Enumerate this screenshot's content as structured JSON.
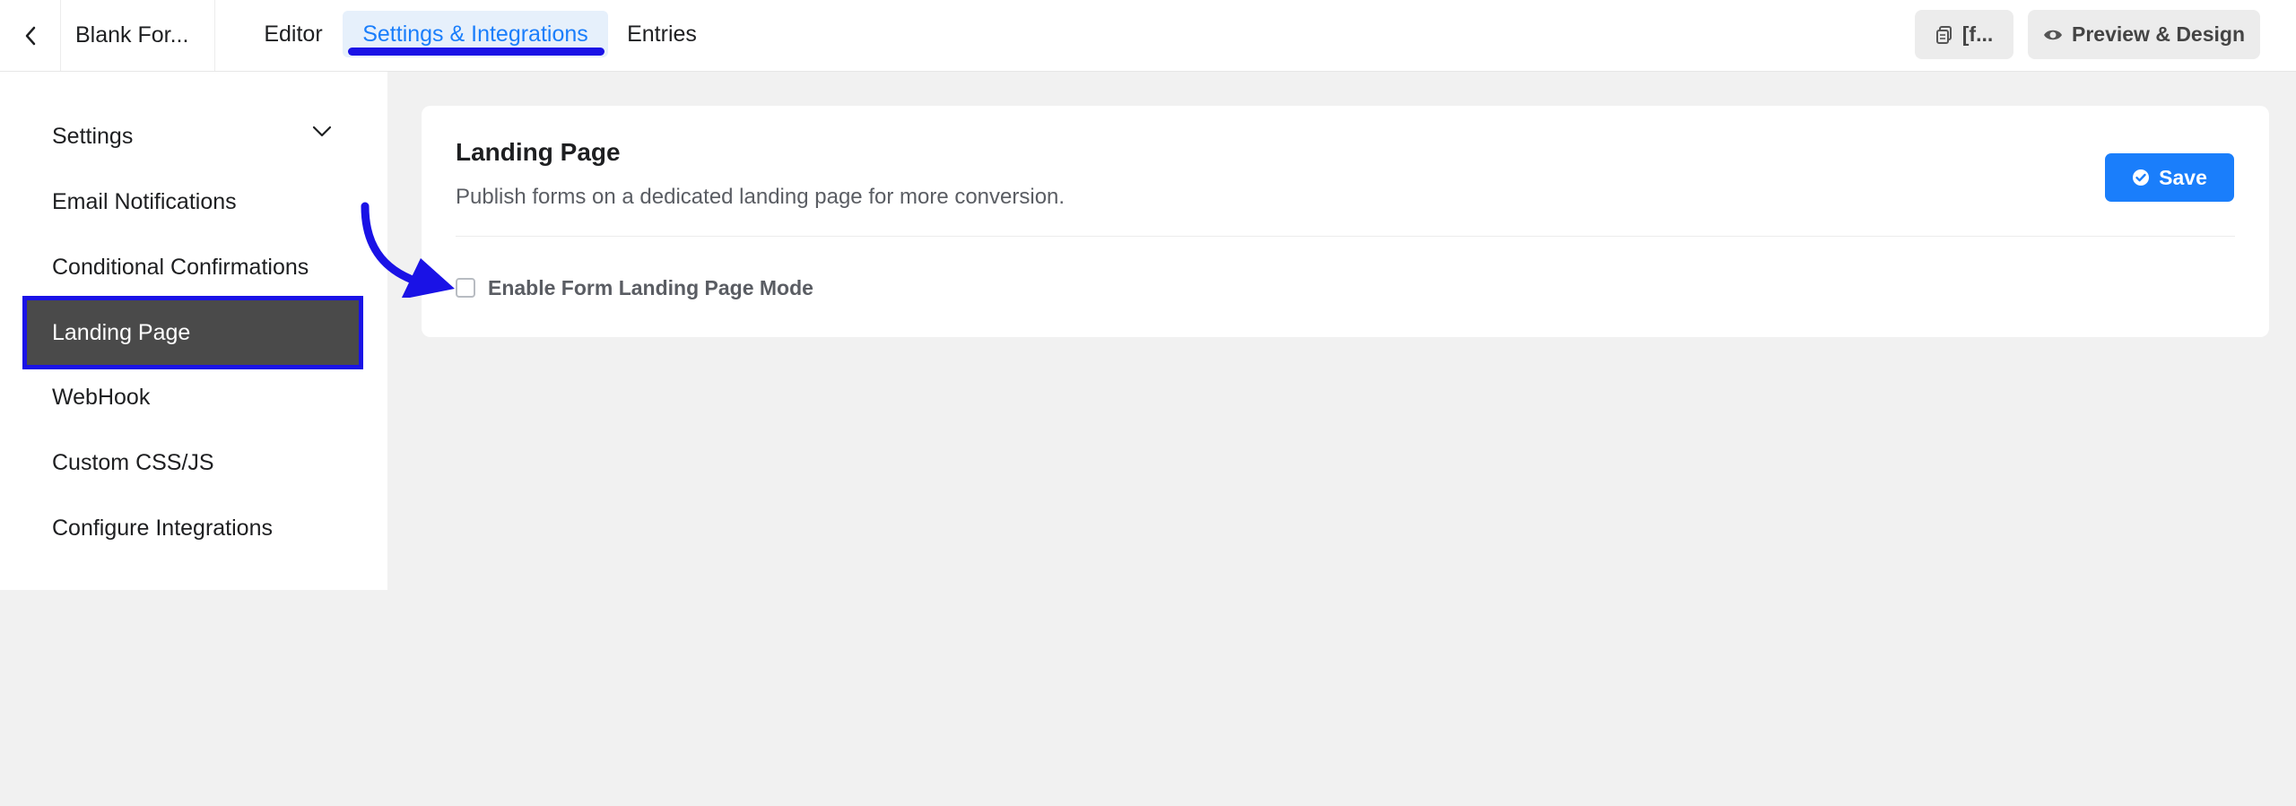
{
  "header": {
    "back_icon": "chevron-left-icon",
    "form_title": "Blank For...",
    "tabs": [
      {
        "label": "Editor"
      },
      {
        "label": "Settings & Integrations"
      },
      {
        "label": "Entries"
      }
    ],
    "active_tab": "Settings & Integrations",
    "shortcode_label": "[f...",
    "preview_label": "Preview & Design"
  },
  "sidebar": {
    "items": [
      {
        "label": "Settings"
      },
      {
        "label": "Email Notifications"
      },
      {
        "label": "Conditional Confirmations"
      },
      {
        "label": "Landing Page"
      },
      {
        "label": "WebHook"
      },
      {
        "label": "Custom CSS/JS"
      },
      {
        "label": "Configure Integrations"
      }
    ],
    "active_item": "Landing Page"
  },
  "main": {
    "title": "Landing Page",
    "description": "Publish forms on a dedicated landing page for more conversion.",
    "save_label": "Save",
    "checkbox_label": "Enable Form Landing Page Mode",
    "checkbox_checked": false
  },
  "colors": {
    "accent": "#1a7efb",
    "annotation": "#1a12e6",
    "active_bg": "#4a4a4a"
  }
}
